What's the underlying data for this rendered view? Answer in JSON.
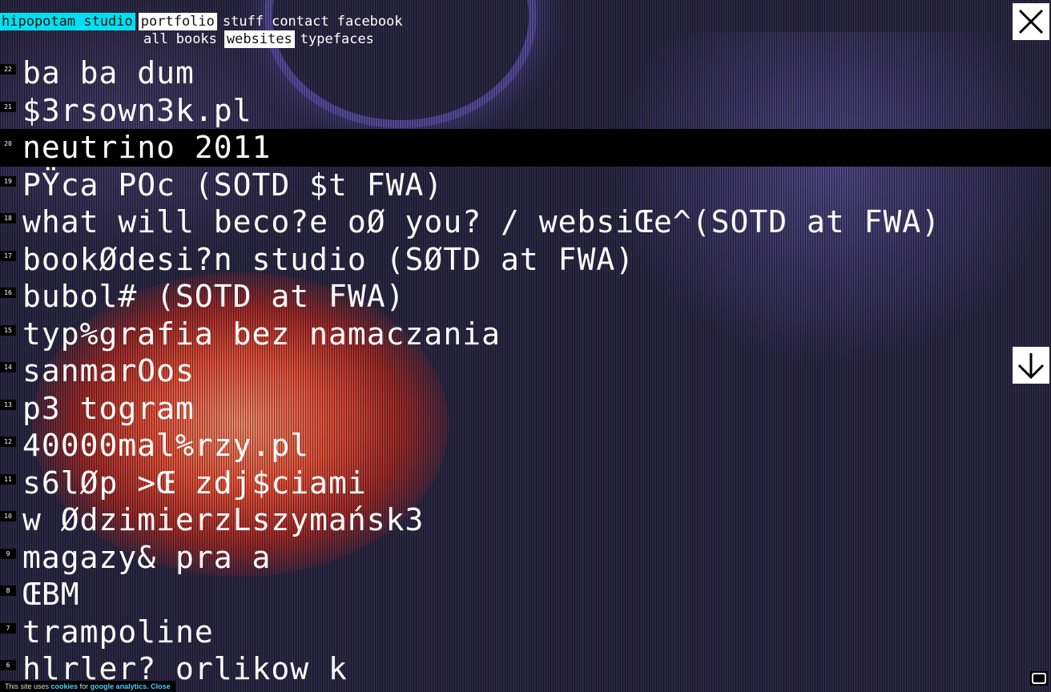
{
  "nav": {
    "brand": "hipopotam studio",
    "main": [
      "portfolio",
      "stuff",
      "contact",
      "facebook"
    ],
    "sub": [
      "all",
      "books",
      "websites",
      "typefaces"
    ]
  },
  "projects": [
    {
      "num": "22",
      "title": "ba ba dum"
    },
    {
      "num": "21",
      "title": "$3rsown3k.pl"
    },
    {
      "num": "20",
      "title": "neutrino 2011"
    },
    {
      "num": "19",
      "title": "PŸca POc (SOTD $t FWA)"
    },
    {
      "num": "18",
      "title": "what will beco?e oØ you? / websiŒe^(SOTD at FWA)"
    },
    {
      "num": "17",
      "title": "bookØdesi?n studio (SØTD at FWA)"
    },
    {
      "num": "16",
      "title": "bubol# (SOTD at FWA)"
    },
    {
      "num": "15",
      "title": "typ%grafia bez namaczania"
    },
    {
      "num": "14",
      "title": "sanmarOos"
    },
    {
      "num": "13",
      "title": "p3 togram"
    },
    {
      "num": "12",
      "title": "40000mal%rzy.pl"
    },
    {
      "num": "11",
      "title": "s6lØp >Œ zdj$ciami"
    },
    {
      "num": "10",
      "title": "w ØdzimierzLszymańsk3"
    },
    {
      "num": "9",
      "title": "magazy& pra a"
    },
    {
      "num": "8",
      "title": "ŒBM"
    },
    {
      "num": "7",
      "title": "trampoline"
    },
    {
      "num": "6",
      "title": "hlrler? orlikow k"
    }
  ],
  "cookie": {
    "prefix": "This site uses",
    "cookies_link": "cookies",
    "middle": "for",
    "analytics_link": "google analytics.",
    "close": "Close"
  },
  "icons": {
    "close": "close-icon",
    "down": "arrow-down-icon",
    "corner": "fullscreen-icon"
  },
  "colors": {
    "accent": "#00e0f0",
    "background": "#2c2846",
    "highlight_row": "#000000",
    "link": "#4ad0ff"
  }
}
